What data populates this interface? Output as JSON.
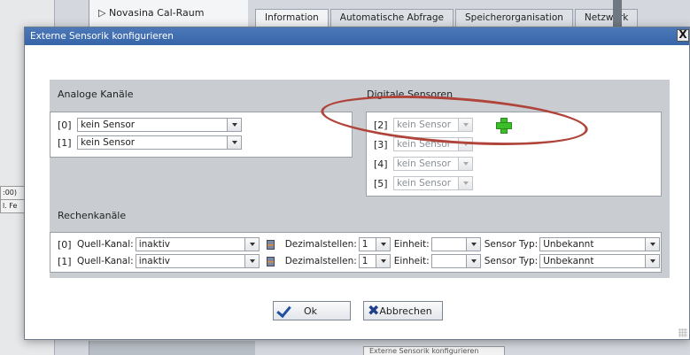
{
  "background": {
    "tree_item": "Novasina Cal-Raum",
    "tabs": [
      "Information",
      "Automatische Abfrage",
      "Speicherorganisation",
      "Netzwerk"
    ],
    "left_cells": [
      ":00)",
      "l. Fe"
    ],
    "bottom_tab": "Externe Sensorik konfigurieren"
  },
  "dialog": {
    "title": "Externe Sensorik konfigurieren",
    "close_label": "X"
  },
  "analog": {
    "label": "Analoge Kanäle",
    "rows": [
      {
        "index": "[0]",
        "value": "kein Sensor"
      },
      {
        "index": "[1]",
        "value": "kein Sensor"
      }
    ]
  },
  "digital": {
    "label": "Digitale Sensoren",
    "rows": [
      {
        "index": "[2]",
        "value": "kein Sensor"
      },
      {
        "index": "[3]",
        "value": "kein Sensor"
      },
      {
        "index": "[4]",
        "value": "kein Sensor"
      },
      {
        "index": "[5]",
        "value": "kein Sensor"
      }
    ]
  },
  "calc": {
    "label": "Rechenkanäle",
    "source_label": "Quell-Kanal:",
    "decimals_label": "Dezimalstellen:",
    "unit_label": "Einheit:",
    "type_label": "Sensor Typ:",
    "rows": [
      {
        "index": "[0]",
        "source": "inaktiv",
        "decimals": "1",
        "unit": "",
        "type": "Unbekannt"
      },
      {
        "index": "[1]",
        "source": "inaktiv",
        "decimals": "1",
        "unit": "",
        "type": "Unbekannt"
      }
    ]
  },
  "buttons": {
    "ok": "Ok",
    "cancel": "Abbrechen"
  },
  "colors": {
    "titlebar": "#3d6db0",
    "annotation": "#b0443a",
    "add_icon": "#3cbe2a"
  },
  "icons": {
    "add": "plus-icon",
    "calc": "calculator-icon",
    "ok": "check-icon",
    "cancel": "x-icon"
  }
}
